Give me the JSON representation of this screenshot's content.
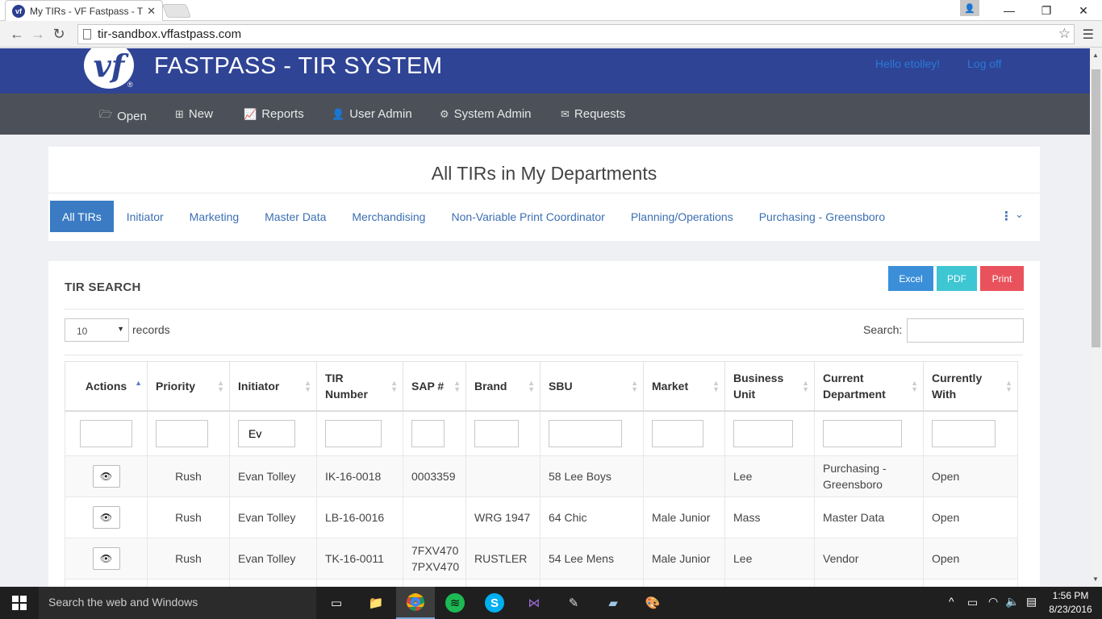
{
  "browser": {
    "tab_title": "My TIRs - VF Fastpass - TIR",
    "favicon_text": "vf",
    "url": "tir-sandbox.vffastpass.com"
  },
  "header": {
    "logo_text": "vf",
    "logo_mark": "®",
    "title": "FASTPASS - TIR SYSTEM",
    "greeting": "Hello etolley!",
    "logoff": "Log off"
  },
  "nav": [
    {
      "label": "Open",
      "icon": "folder-open-icon"
    },
    {
      "label": "New",
      "icon": "plus-square-icon"
    },
    {
      "label": "Reports",
      "icon": "line-chart-icon"
    },
    {
      "label": "User Admin",
      "icon": "user-icon"
    },
    {
      "label": "System Admin",
      "icon": "gears-icon"
    },
    {
      "label": "Requests",
      "icon": "envelope-icon"
    }
  ],
  "departments": {
    "heading": "All TIRs in My Departments",
    "tabs": [
      "All TIRs",
      "Initiator",
      "Marketing",
      "Master Data",
      "Merchandising",
      "Non-Variable Print Coordinator",
      "Planning/Operations",
      "Purchasing - Greensboro"
    ],
    "active_tab": "All TIRs"
  },
  "search_section": {
    "title": "TIR SEARCH",
    "buttons": [
      {
        "label": "Excel",
        "color": "#3b8fd9"
      },
      {
        "label": "PDF",
        "color": "#3ec6d3"
      },
      {
        "label": "Print",
        "color": "#e9525c"
      }
    ],
    "page_length": "10",
    "records_label": "records",
    "search_label": "Search:",
    "search_value": ""
  },
  "table": {
    "columns": [
      "Actions",
      "Priority",
      "Initiator",
      "TIR Number",
      "SAP #",
      "Brand",
      "SBU",
      "Market",
      "Business Unit",
      "Current Department",
      "Currently With"
    ],
    "filters": [
      "",
      "",
      "Ev",
      "",
      "",
      "",
      "",
      "",
      "",
      "",
      ""
    ],
    "rows": [
      [
        "",
        "Rush",
        "Evan Tolley",
        "IK-16-0018",
        "0003359",
        "",
        "58 Lee Boys",
        "",
        "Lee",
        "Purchasing - Greensboro",
        "Open"
      ],
      [
        "",
        "Rush",
        "Evan Tolley",
        "LB-16-0016",
        "",
        "WRG 1947",
        "64 Chic",
        "Male Junior",
        "Mass",
        "Master Data",
        "Open"
      ],
      [
        "",
        "Rush",
        "Evan Tolley",
        "TK-16-0011",
        "7FXV470 7PXV470",
        "RUSTLER",
        "54 Lee Mens",
        "Male Junior",
        "Lee",
        "Vendor",
        "Open"
      ]
    ]
  },
  "taskbar": {
    "search_placeholder": "Search the web and Windows",
    "time": "1:56 PM",
    "date": "8/23/2016"
  }
}
